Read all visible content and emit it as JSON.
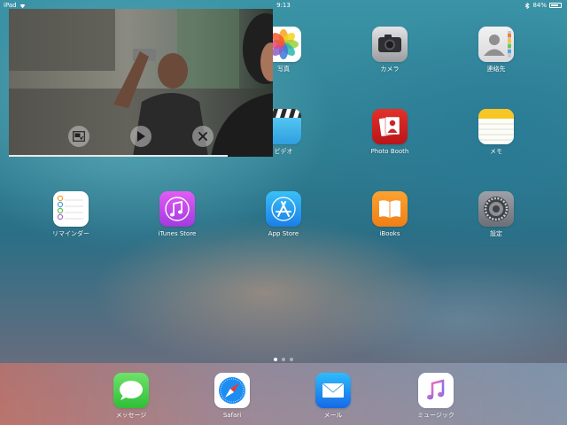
{
  "status_bar": {
    "device": "iPad",
    "time": "9:13",
    "battery_percent_text": "84%",
    "battery_level": 0.84
  },
  "apps": {
    "photos": "写真",
    "camera": "カメラ",
    "contacts": "連絡先",
    "videos": "ビデオ",
    "photo_booth": "Photo Booth",
    "notes": "メモ",
    "reminders": "リマインダー",
    "itunes_store": "iTunes Store",
    "app_store": "App Store",
    "ibooks": "iBooks",
    "settings": "設定"
  },
  "dock": {
    "messages": "メッセージ",
    "safari": "Safari",
    "mail": "メール",
    "music": "ミュージック"
  },
  "page_indicator": {
    "pages": 3,
    "current": 1
  },
  "pip": {
    "progress": 0.83,
    "controls": [
      "picture-in-picture-icon",
      "play-icon",
      "close-icon"
    ]
  }
}
